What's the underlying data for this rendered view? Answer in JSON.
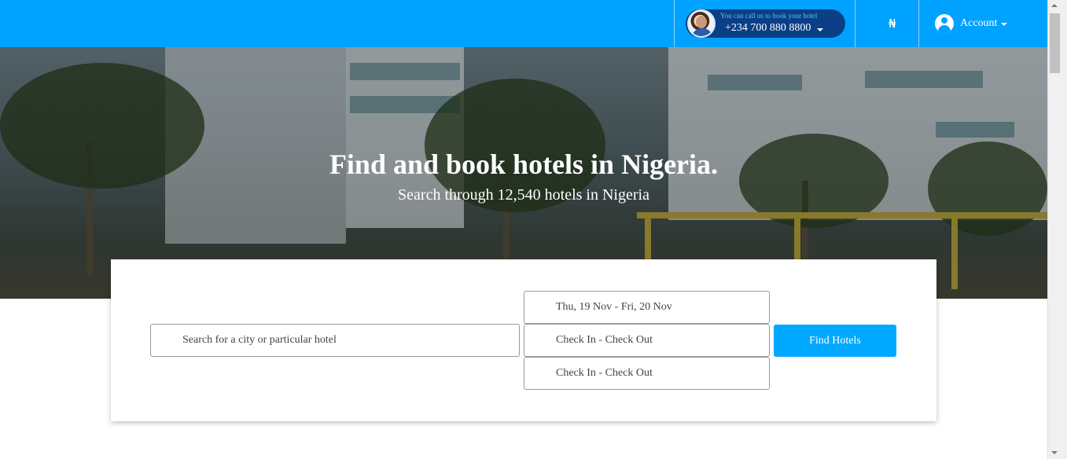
{
  "header": {
    "call_tagline": "You can call us to book your hotel",
    "phone": "+234 700 880 8800",
    "currency_symbol": "₦",
    "account_label": "Account"
  },
  "hero": {
    "title": "Find and book hotels in Nigeria.",
    "subtitle": "Search through 12,540 hotels in Nigeria"
  },
  "search": {
    "destination_placeholder": "Search for a city or particular hotel",
    "dates_value": "Thu, 19 Nov - Fri, 20 Nov",
    "checkin_checkout_1": "Check In - Check Out",
    "checkin_checkout_2": "Check In - Check Out",
    "submit_label": "Find Hotels"
  },
  "colors": {
    "brand_blue": "#00a2ff",
    "pill_navy": "#0a3f86",
    "button_blue": "#00a8ff"
  },
  "icons": {
    "call_avatar": "agent-avatar-icon",
    "account": "user-circle-icon",
    "dropdown": "caret-down-icon"
  }
}
